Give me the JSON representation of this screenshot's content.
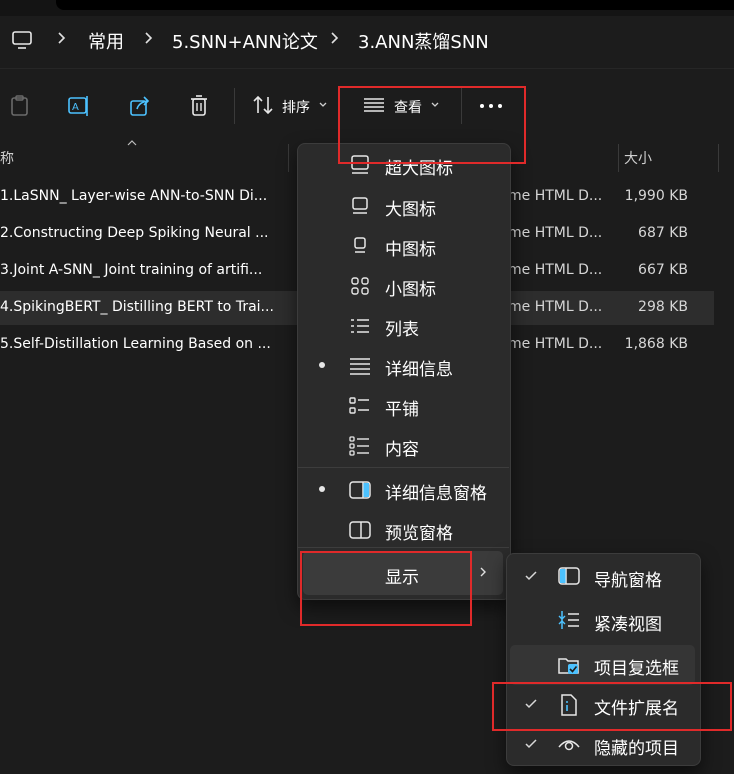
{
  "breadcrumb": {
    "items": [
      "常用",
      "5.SNN+ANN论文",
      "3.ANN蒸馏SNN"
    ]
  },
  "toolbar": {
    "sort_label": "排序",
    "view_label": "查看"
  },
  "columns": {
    "name": "称",
    "size": "大小"
  },
  "files": [
    {
      "name": "1.LaSNN_ Layer-wise ANN-to-SNN Di...",
      "type": "me HTML D...",
      "size": "1,990 KB"
    },
    {
      "name": "2.Constructing Deep Spiking Neural ...",
      "type": "me HTML D...",
      "size": "687 KB"
    },
    {
      "name": "3.Joint A-SNN_ Joint training of artifi...",
      "type": "me HTML D...",
      "size": "667 KB"
    },
    {
      "name": "4.SpikingBERT_ Distilling BERT to Trai...",
      "type": "me HTML D...",
      "size": "298 KB"
    },
    {
      "name": "5.Self-Distillation Learning Based on ...",
      "type": "me HTML D...",
      "size": "1,868 KB"
    }
  ],
  "view_menu": {
    "items": [
      "超大图标",
      "大图标",
      "中图标",
      "小图标",
      "列表",
      "详细信息",
      "平铺",
      "内容",
      "详细信息窗格",
      "预览窗格",
      "显示"
    ]
  },
  "show_submenu": {
    "items": [
      "导航窗格",
      "紧凑视图",
      "项目复选框",
      "文件扩展名",
      "隐藏的项目"
    ]
  },
  "colors": {
    "background": "#1c1c1c",
    "menu": "#2b2b2b",
    "accent_blue": "#4cc2ff",
    "highlight_red": "#e02a2a"
  }
}
